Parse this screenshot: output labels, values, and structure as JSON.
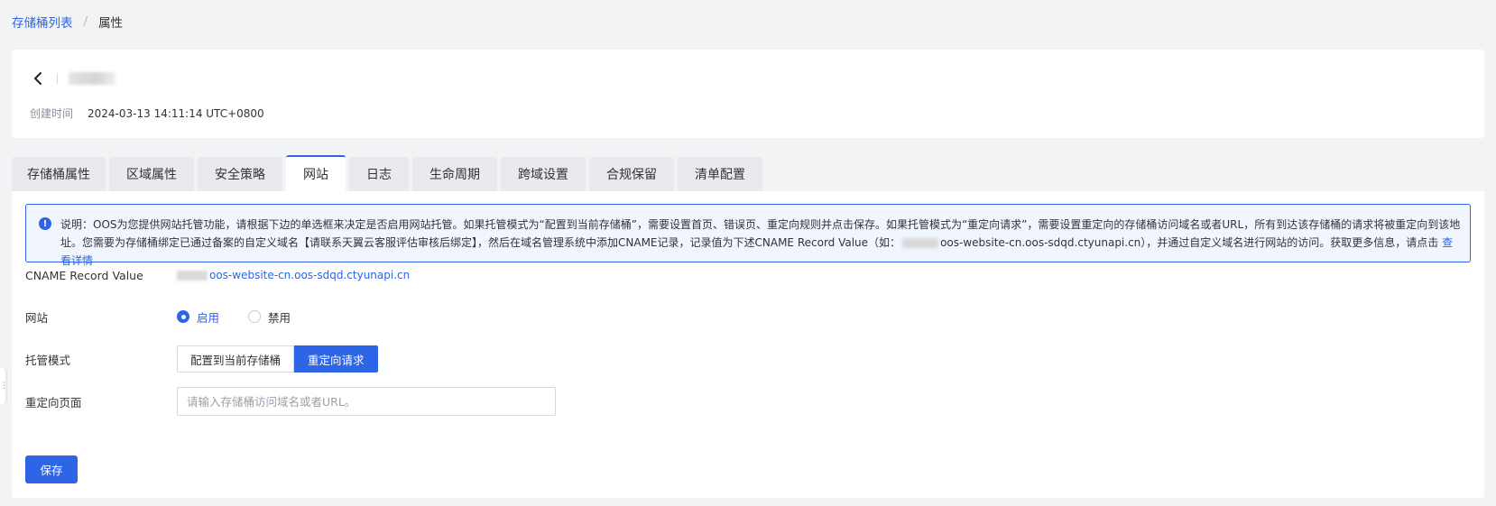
{
  "breadcrumb": {
    "parent": "存储桶列表",
    "separator": "/",
    "current": "属性"
  },
  "header": {
    "created_label": "创建时间",
    "created_value": "2024-03-13 14:11:14 UTC+0800"
  },
  "tabs": [
    {
      "label": "存储桶属性",
      "active": false
    },
    {
      "label": "区域属性",
      "active": false
    },
    {
      "label": "安全策略",
      "active": false
    },
    {
      "label": "网站",
      "active": true
    },
    {
      "label": "日志",
      "active": false
    },
    {
      "label": "生命周期",
      "active": false
    },
    {
      "label": "跨域设置",
      "active": false
    },
    {
      "label": "合规保留",
      "active": false
    },
    {
      "label": "清单配置",
      "active": false
    }
  ],
  "notice": {
    "icon": "info-icon",
    "text_part1": "说明：OOS为您提供网站托管功能，请根据下边的单选框来决定是否启用网站托管。如果托管模式为“配置到当前存储桶”，需要设置首页、错误页、重定向规则并点击保存。如果托管模式为“重定向请求”，需要设置重定向的存储桶访问域名或者URL，所有到达该存储桶的请求将被重定向到该地址。您需要为存储桶绑定已通过备案的自定义域名【请联系天翼云客服评估审核后绑定】，然后在域名管理系统中添加CNAME记录，记录值为下述CNAME Record Value（如：",
    "text_part2": "oos-website-cn.oos-sdqd.ctyunapi.cn），并通过自定义域名进行网站的访问。获取更多信息，请点击",
    "link": "查看详情"
  },
  "form": {
    "cname_label": "CNAME Record Value",
    "cname_value": "oos-website-cn.oos-sdqd.ctyunapi.cn",
    "website_label": "网站",
    "website_options": [
      {
        "label": "启用",
        "checked": true
      },
      {
        "label": "禁用",
        "checked": false
      }
    ],
    "mode_label": "托管模式",
    "mode_options": [
      {
        "label": "配置到当前存储桶",
        "active": false
      },
      {
        "label": "重定向请求",
        "active": true
      }
    ],
    "redirect_label": "重定向页面",
    "redirect_placeholder": "请输入存储桶访问域名或者URL。",
    "redirect_value": ""
  },
  "actions": {
    "save_label": "保存"
  },
  "colors": {
    "primary": "#2e64e6",
    "page_bg": "#f2f3f5",
    "notice_bg": "#f1f5fe"
  }
}
